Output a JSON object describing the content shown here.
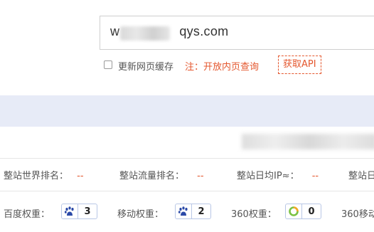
{
  "search": {
    "value_prefix": "w",
    "value_suffix": "qys.com"
  },
  "options": {
    "cache_label": "更新网页缓存",
    "note": "注：开放内页查询",
    "api_button": "获取API"
  },
  "stats_row1": [
    {
      "label": "整站世界排名：",
      "value": "--"
    },
    {
      "label": "整站流量排名：",
      "value": "--"
    },
    {
      "label": "整站日均IP≈：",
      "value": "--"
    },
    {
      "label": "整站日"
    }
  ],
  "stats_row2": [
    {
      "label": "百度权重：",
      "icon": "baidu-paw-icon",
      "value": "3"
    },
    {
      "label": "移动权重：",
      "icon": "baidu-paw-icon",
      "value": "2"
    },
    {
      "label": "360权重：",
      "icon": "360-ring-icon",
      "value": "0"
    },
    {
      "label": "360移动"
    }
  ]
}
